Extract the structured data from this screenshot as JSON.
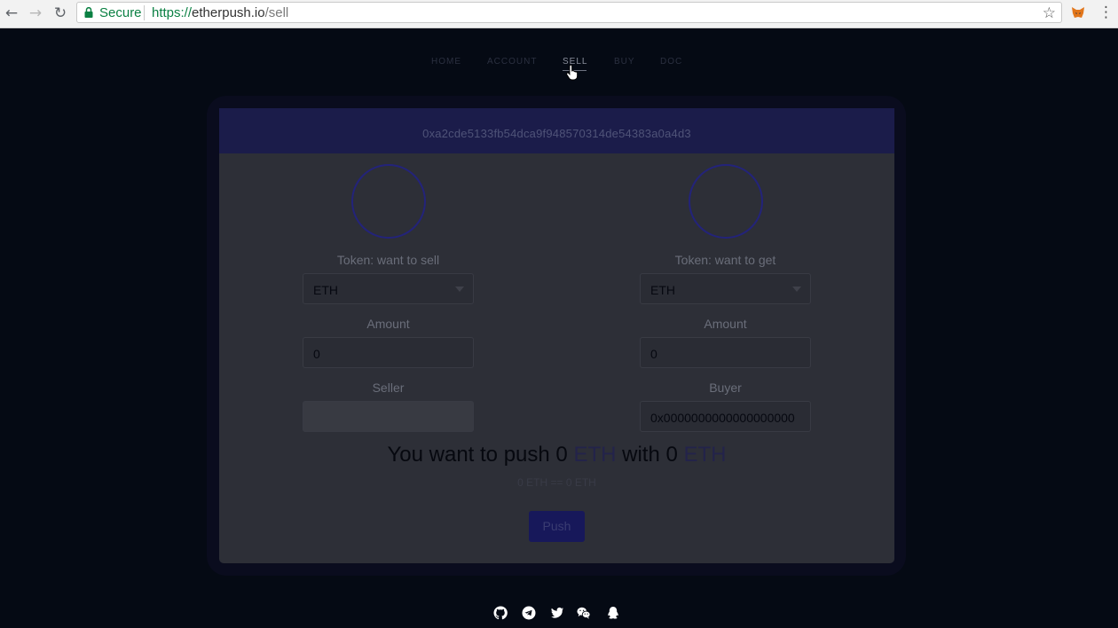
{
  "browser": {
    "secure_label": "Secure",
    "url_scheme": "https://",
    "url_host": "etherpush.io",
    "url_path": "/sell"
  },
  "nav": {
    "items": [
      {
        "label": "HOME",
        "active": false
      },
      {
        "label": "ACCOUNT",
        "active": false
      },
      {
        "label": "SELL",
        "active": true
      },
      {
        "label": "BUY",
        "active": false
      },
      {
        "label": "DOC",
        "active": false
      }
    ]
  },
  "card": {
    "address": "0xa2cde5133fb54dca9f948570314de54383a0a4d3",
    "sell": {
      "token_label": "Token: want to sell",
      "token_value": "ETH",
      "amount_label": "Amount",
      "amount_value": "0",
      "party_label": "Seller",
      "party_value": ""
    },
    "get": {
      "token_label": "Token: want to get",
      "token_value": "ETH",
      "amount_label": "Amount",
      "amount_value": "0",
      "party_label": "Buyer",
      "party_value": "0x0000000000000000000"
    },
    "summary": {
      "prefix": "You want to push ",
      "sell_amount": "0",
      "sell_token": "ETH",
      "middle": " with ",
      "get_amount": "0",
      "get_token": "ETH"
    },
    "rate": "0 ETH == 0 ETH",
    "push_label": "Push"
  },
  "footer": {
    "icons": [
      "github-icon",
      "telegram-icon",
      "twitter-icon",
      "wechat-icon",
      "qq-icon"
    ]
  },
  "colors": {
    "background": "#050a14",
    "card": "#2d2f37",
    "header": "#1b1c4a",
    "accent": "#17185a"
  }
}
